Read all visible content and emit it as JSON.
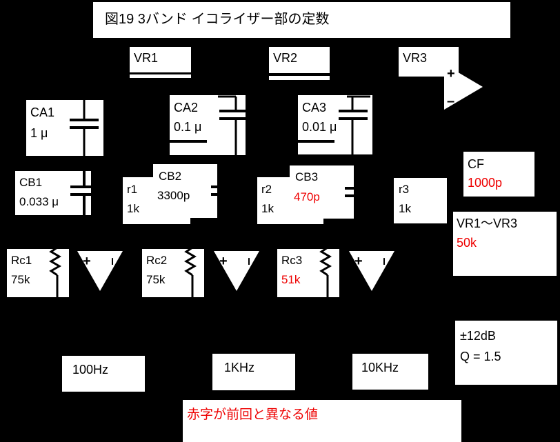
{
  "figure": {
    "title": "図19  3バンド イコライザー部の定数",
    "footnote": "赤字が前回と異なる値",
    "colors": {
      "background": "#000000",
      "box_fill": "#ffffff",
      "text": "#000000",
      "changed_value": "#ee0000"
    }
  },
  "potentiometers": [
    {
      "name": "VR1"
    },
    {
      "name": "VR2"
    },
    {
      "name": "VR3"
    }
  ],
  "capacitors_a": [
    {
      "name": "CA1",
      "value": "1 μ",
      "changed": false
    },
    {
      "name": "CA2",
      "value": "0.1 μ",
      "changed": false
    },
    {
      "name": "CA3",
      "value": "0.01 μ",
      "changed": false
    }
  ],
  "capacitors_b": [
    {
      "name": "CB1",
      "value": "0.033 μ",
      "changed": false
    },
    {
      "name": "CB2",
      "value": "3300p",
      "changed": false
    },
    {
      "name": "CB3",
      "value": "470p",
      "changed": true
    }
  ],
  "resistors_r": [
    {
      "name": "r1",
      "value": "1k"
    },
    {
      "name": "r2",
      "value": "1k"
    },
    {
      "name": "r3",
      "value": "1k"
    }
  ],
  "resistors_rc": [
    {
      "name": "Rc1",
      "value": "75k",
      "changed": false
    },
    {
      "name": "Rc2",
      "value": "75k",
      "changed": false
    },
    {
      "name": "Rc3",
      "value": "51k",
      "changed": true
    }
  ],
  "feedback": {
    "name": "CF",
    "value": "1000p",
    "changed": true
  },
  "vr_range": {
    "name": "VR1～VR3",
    "value": "50k",
    "changed": true
  },
  "bands": [
    {
      "frequency": "100Hz"
    },
    {
      "frequency": "1KHz"
    },
    {
      "frequency": "10KHz"
    }
  ],
  "spec": {
    "boost_cut": "±12dB",
    "q_factor": "Q = 1.5"
  },
  "opamp": {
    "plus": "+",
    "minus": "–"
  }
}
